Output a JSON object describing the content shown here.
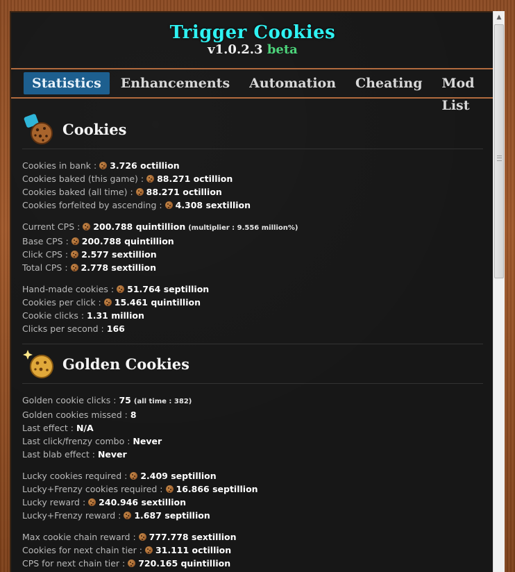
{
  "app": {
    "title": "Trigger Cookies",
    "version": "v1.0.2.3",
    "channel": "beta"
  },
  "nav": {
    "tabs": [
      {
        "label": "Statistics",
        "active": true
      },
      {
        "label": "Enhancements",
        "active": false
      },
      {
        "label": "Automation",
        "active": false
      },
      {
        "label": "Cheating",
        "active": false
      },
      {
        "label": "Mod List",
        "active": false
      }
    ]
  },
  "sections": {
    "cookies": {
      "title": "Cookies",
      "icon": "cookie-stack-icon",
      "groups": [
        [
          {
            "label": "Cookies in bank :",
            "value": "3.726 octillion"
          },
          {
            "label": "Cookies baked (this game) :",
            "value": "88.271 octillion"
          },
          {
            "label": "Cookies baked (all time) :",
            "value": "88.271 octillion"
          },
          {
            "label": "Cookies forfeited by ascending :",
            "value": "4.308 sextillion"
          }
        ],
        [
          {
            "label": "Current CPS :",
            "value": "200.788 quintillion",
            "note": "(multiplier : 9.556 million%)"
          },
          {
            "label": "Base CPS :",
            "value": "200.788 quintillion"
          },
          {
            "label": "Click CPS :",
            "value": "2.577 sextillion"
          },
          {
            "label": "Total CPS :",
            "value": "2.778 sextillion"
          }
        ],
        [
          {
            "label": "Hand-made cookies :",
            "value": "51.764 septillion"
          },
          {
            "label": "Cookies per click :",
            "value": "15.461 quintillion"
          },
          {
            "label": "Cookie clicks :",
            "value": "1.31 million"
          },
          {
            "label": "Clicks per second :",
            "value": "166"
          }
        ]
      ]
    },
    "golden": {
      "title": "Golden Cookies",
      "icon": "golden-cookie-icon",
      "groups": [
        [
          {
            "label": "Golden cookie clicks :",
            "value": "75",
            "note": "(all time : 382)"
          },
          {
            "label": "Golden cookies missed :",
            "value": "8"
          },
          {
            "label": "Last effect :",
            "value": "N/A"
          },
          {
            "label": "Last click/frenzy combo :",
            "value": "Never"
          },
          {
            "label": "Last blab effect :",
            "value": "Never"
          }
        ],
        [
          {
            "label": "Lucky cookies required :",
            "value": "2.409 septillion"
          },
          {
            "label": "Lucky+Frenzy cookies required :",
            "value": "16.866 septillion"
          },
          {
            "label": "Lucky reward :",
            "value": "240.946 sextillion"
          },
          {
            "label": "Lucky+Frenzy reward :",
            "value": "1.687 septillion"
          }
        ],
        [
          {
            "label": "Max cookie chain reward :",
            "value": "777.778 sextillion"
          },
          {
            "label": "Cookies for next chain tier :",
            "value": "31.111 octillion"
          },
          {
            "label": "CPS for next chain tier :",
            "value": "720.165 quintillion"
          }
        ]
      ]
    }
  },
  "colors": {
    "title": "#2ff2f2",
    "beta": "#4cd37a",
    "active_tab": "#1d5f8f",
    "frame": "#a0582a"
  }
}
